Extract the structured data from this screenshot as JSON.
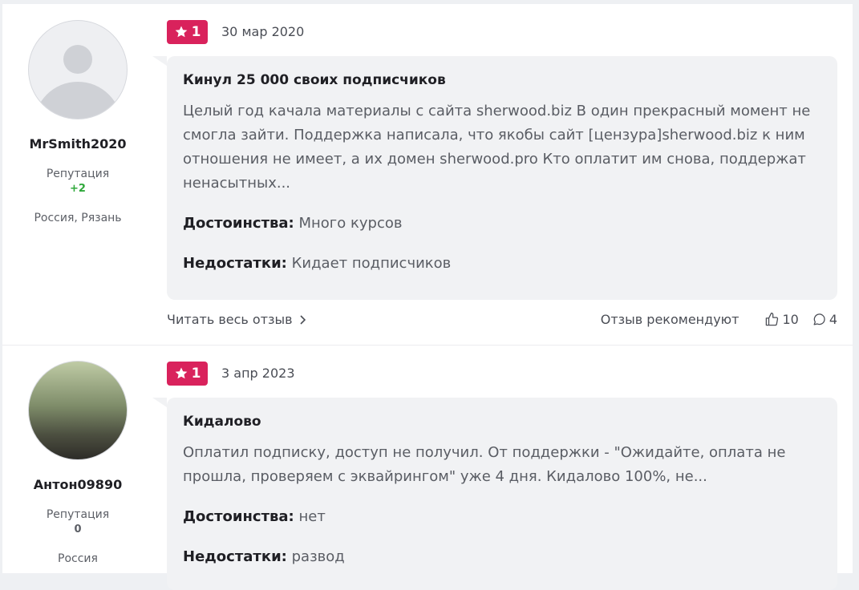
{
  "reviews": [
    {
      "author": {
        "name": "MrSmith2020",
        "reputation_label": "Репутация",
        "reputation_value": "+2",
        "location": "Россия, Рязань"
      },
      "rating": "1",
      "date": "30 мар 2020",
      "title": "Кинул 25 000 своих подписчиков",
      "text": "Целый год качала материалы с сайта sherwood.biz В один прекрасный момент не смогла зайти. Поддержка написала, что якобы сайт [цензура]sherwood.biz к ним отношения не имеет, а их домен sherwood.pro Кто оплатит им снова, поддержат ненасытных...",
      "pros_label": "Достоинства:",
      "pros": "Много курсов",
      "cons_label": "Недостатки:",
      "cons": "Кидает подписчиков",
      "read_more": "Читать весь отзыв",
      "recommend_label": "Отзыв рекомендуют",
      "likes": "10",
      "comments": "4"
    },
    {
      "author": {
        "name": "Антон09890",
        "reputation_label": "Репутация",
        "reputation_value": "0",
        "location": "Россия"
      },
      "rating": "1",
      "date": "3 апр 2023",
      "title": "Кидалово",
      "text": "Оплатил подписку, доступ не получил. От поддержки - \"Ожидайте, оплата не прошла, проверяем с эквайрингом\" уже 4 дня. Кидалово 100%, не...",
      "pros_label": "Достоинства:",
      "pros": "нет",
      "cons_label": "Недостатки:",
      "cons": "развод"
    }
  ],
  "colors": {
    "rating_badge": "#d9225c",
    "reputation_positive": "#2ea83a",
    "bubble": "#f1f2f4"
  },
  "icons": [
    "star-icon",
    "chevron-right-icon",
    "thumbs-up-icon",
    "comment-icon",
    "default-avatar-icon"
  ]
}
